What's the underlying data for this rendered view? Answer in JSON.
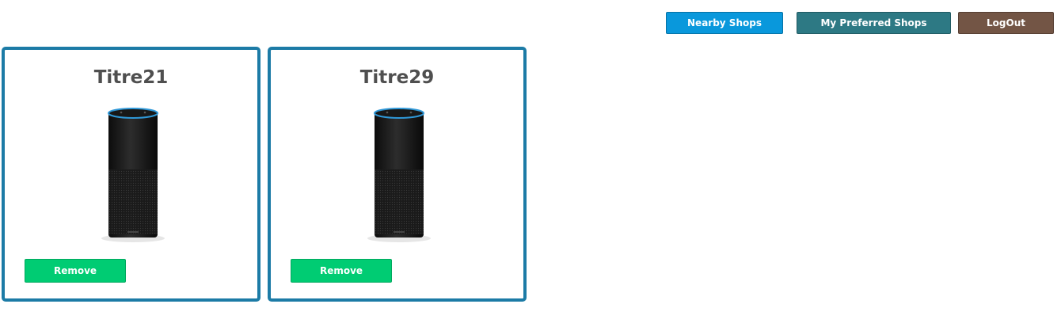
{
  "nav": {
    "nearby": {
      "label": "Nearby Shops",
      "color": "#0998dc"
    },
    "preferred": {
      "label": "My Preferred Shops",
      "color": "#2d7984"
    },
    "logout": {
      "label": "LogOut",
      "color": "#735545"
    }
  },
  "shops": [
    {
      "title": "Titre21",
      "image_icon": "smart-speaker-image",
      "action_label": "Remove"
    },
    {
      "title": "Titre29",
      "image_icon": "smart-speaker-image",
      "action_label": "Remove"
    }
  ],
  "colors": {
    "card_border": "#1c7ba6",
    "remove_button": "#00cc73",
    "title_text": "#4f4f4f"
  }
}
